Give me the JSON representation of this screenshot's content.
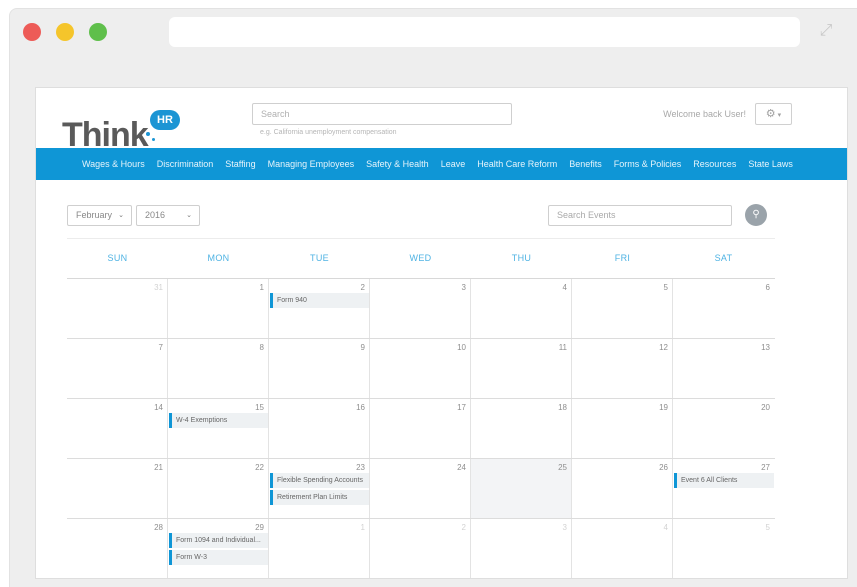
{
  "browser": {
    "url": ""
  },
  "header": {
    "logo": {
      "text": "Think",
      "badge": "HR"
    },
    "search": {
      "placeholder": "Search",
      "hint": "e.g. California unemployment compensation"
    },
    "welcome": "Welcome back User!",
    "settings_icon": "gear-icon"
  },
  "nav": {
    "items": [
      "Wages & Hours",
      "Discrimination",
      "Staffing",
      "Managing Employees",
      "Safety & Health",
      "Leave",
      "Health Care Reform",
      "Benefits",
      "Forms & Policies",
      "Resources",
      "State Laws"
    ]
  },
  "calendar": {
    "month": "February",
    "year": "2016",
    "event_search_placeholder": "Search Events",
    "day_headers": [
      "SUN",
      "MON",
      "TUE",
      "WED",
      "THU",
      "FRI",
      "SAT"
    ],
    "weeks": [
      [
        {
          "d": "31",
          "muted": true
        },
        {
          "d": "1"
        },
        {
          "d": "2",
          "events": [
            "Form 940"
          ]
        },
        {
          "d": "3"
        },
        {
          "d": "4"
        },
        {
          "d": "5"
        },
        {
          "d": "6"
        }
      ],
      [
        {
          "d": "7"
        },
        {
          "d": "8"
        },
        {
          "d": "9"
        },
        {
          "d": "10"
        },
        {
          "d": "11"
        },
        {
          "d": "12"
        },
        {
          "d": "13"
        }
      ],
      [
        {
          "d": "14"
        },
        {
          "d": "15",
          "events": [
            "W-4 Exemptions"
          ]
        },
        {
          "d": "16"
        },
        {
          "d": "17"
        },
        {
          "d": "18"
        },
        {
          "d": "19"
        },
        {
          "d": "20"
        }
      ],
      [
        {
          "d": "21"
        },
        {
          "d": "22"
        },
        {
          "d": "23",
          "events": [
            "Flexible Spending Accounts",
            "Retirement Plan Limits"
          ]
        },
        {
          "d": "24"
        },
        {
          "d": "25",
          "shaded": true
        },
        {
          "d": "26"
        },
        {
          "d": "27",
          "events": [
            "Event 6 All Clients"
          ]
        }
      ],
      [
        {
          "d": "28"
        },
        {
          "d": "29",
          "events": [
            "Form 1094 and Individual...",
            "Form W-3"
          ]
        },
        {
          "d": "1",
          "muted": true
        },
        {
          "d": "2",
          "muted": true
        },
        {
          "d": "3",
          "muted": true
        },
        {
          "d": "4",
          "muted": true
        },
        {
          "d": "5",
          "muted": true
        }
      ]
    ]
  },
  "colors": {
    "accent": "#0f96d6",
    "day_header": "#4fb3e3"
  }
}
